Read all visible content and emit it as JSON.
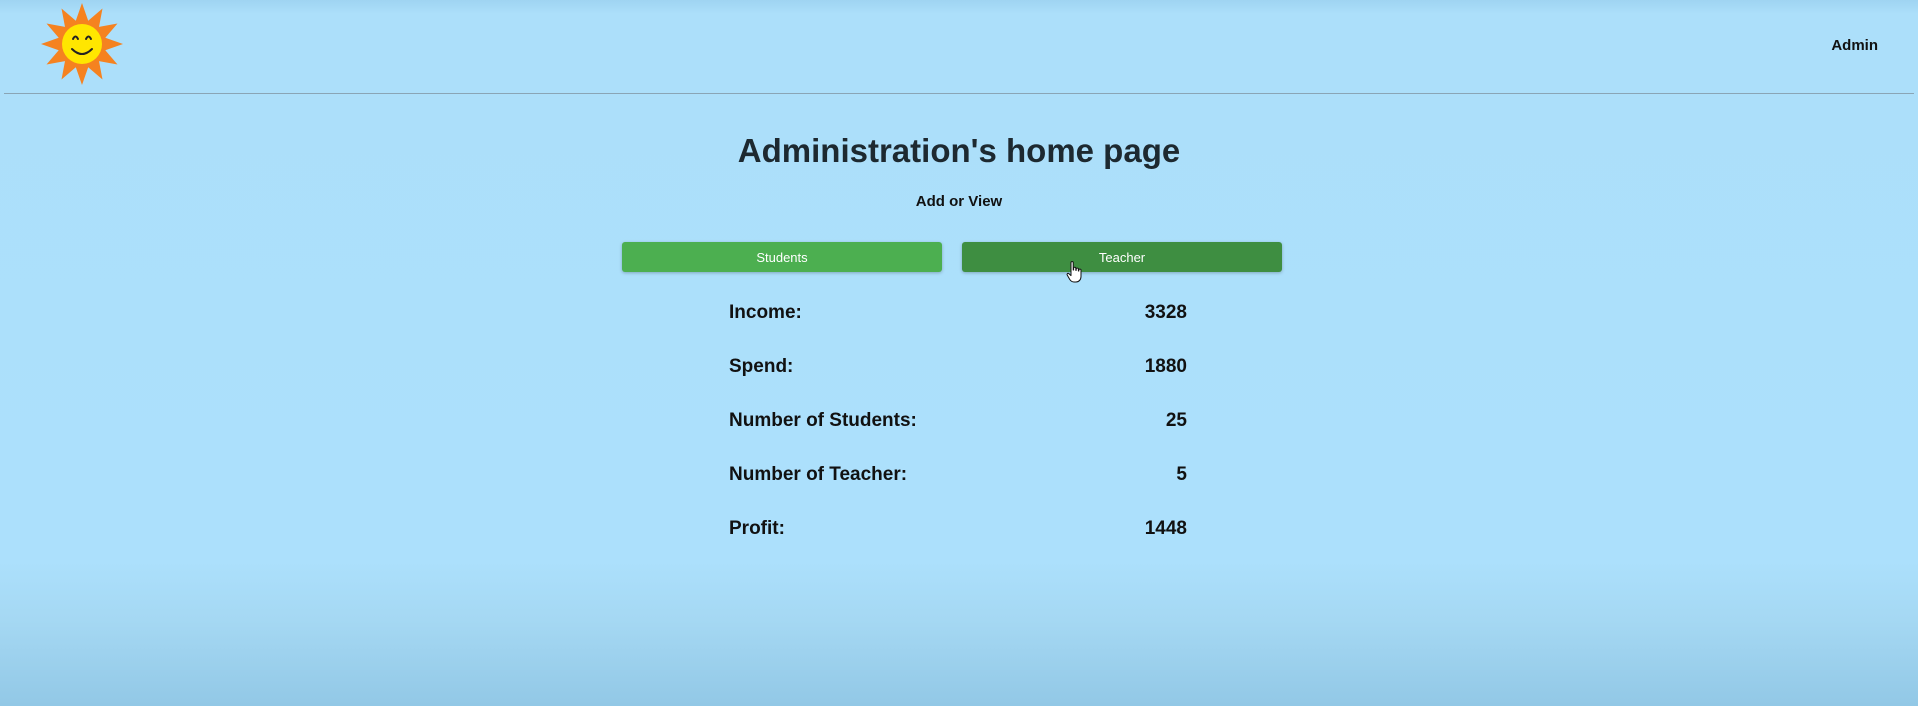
{
  "header": {
    "logo_icon": "smiling-sun-icon",
    "admin_label": "Admin"
  },
  "main": {
    "title": "Administration's home page",
    "subtitle": "Add or View",
    "buttons": {
      "students_label": "Students",
      "teacher_label": "Teacher"
    },
    "stats": [
      {
        "label": "Income:",
        "value": "3328"
      },
      {
        "label": "Spend:",
        "value": "1880"
      },
      {
        "label": "Number of Students:",
        "value": "25"
      },
      {
        "label": "Number of Teacher:",
        "value": "5"
      },
      {
        "label": "Profit:",
        "value": "1448"
      }
    ]
  },
  "colors": {
    "background": "#ace0fc",
    "students_button": "#4caf50",
    "teacher_button_hover": "#3e8e41",
    "sun_rays": "#f58220",
    "sun_face": "#ffe600"
  }
}
